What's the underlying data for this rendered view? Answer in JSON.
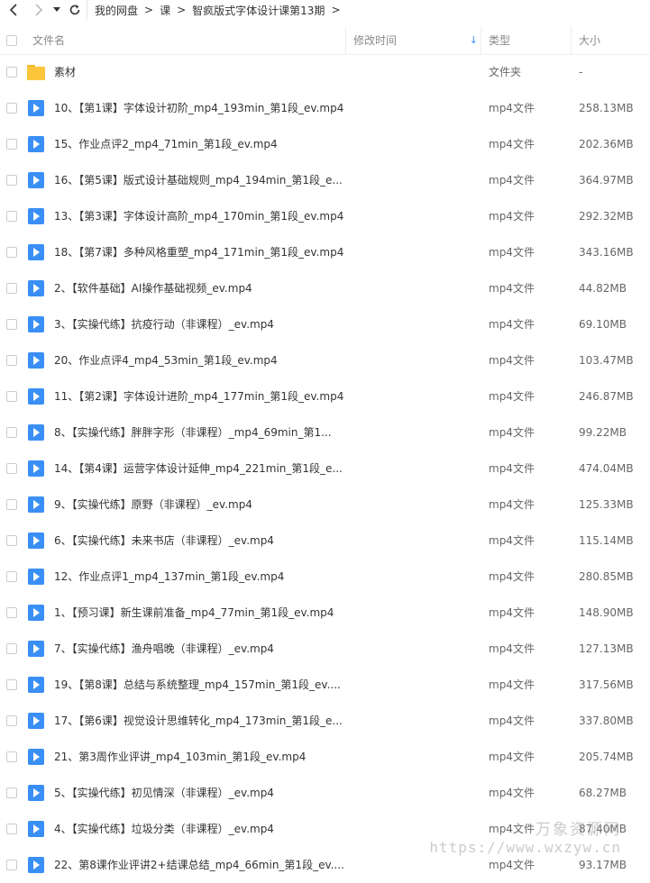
{
  "nav": {
    "breadcrumb": [
      "我的网盘",
      "课",
      "智疯版式字体设计课第13期"
    ],
    "separator": ">"
  },
  "header": {
    "name": "文件名",
    "modified": "修改时间",
    "type": "类型",
    "size": "大小",
    "sort_indicator": "↓"
  },
  "files": [
    {
      "name": "素材",
      "type": "文件夹",
      "size": "-",
      "icon": "folder-icon"
    },
    {
      "name": "10、【第1课】字体设计初阶_mp4_193min_第1段_ev.mp4",
      "type": "mp4文件",
      "size": "258.13MB",
      "icon": "video-file-icon"
    },
    {
      "name": "15、作业点评2_mp4_71min_第1段_ev.mp4",
      "type": "mp4文件",
      "size": "202.36MB",
      "icon": "video-file-icon"
    },
    {
      "name": "16、【第5课】版式设计基础规则_mp4_194min_第1段_e...",
      "type": "mp4文件",
      "size": "364.97MB",
      "icon": "video-file-icon"
    },
    {
      "name": "13、【第3课】字体设计高阶_mp4_170min_第1段_ev.mp4",
      "type": "mp4文件",
      "size": "292.32MB",
      "icon": "video-file-icon"
    },
    {
      "name": "18、【第7课】多种风格重塑_mp4_171min_第1段_ev.mp4",
      "type": "mp4文件",
      "size": "343.16MB",
      "icon": "video-file-icon"
    },
    {
      "name": "2、【软件基础】AI操作基础视频_ev.mp4",
      "type": "mp4文件",
      "size": "44.82MB",
      "icon": "video-file-icon"
    },
    {
      "name": "3、【实操代练】抗疫行动（非课程）_ev.mp4",
      "type": "mp4文件",
      "size": "69.10MB",
      "icon": "video-file-icon"
    },
    {
      "name": "20、作业点评4_mp4_53min_第1段_ev.mp4",
      "type": "mp4文件",
      "size": "103.47MB",
      "icon": "video-file-icon"
    },
    {
      "name": "11、【第2课】字体设计进阶_mp4_177min_第1段_ev.mp4",
      "type": "mp4文件",
      "size": "246.87MB",
      "icon": "video-file-icon"
    },
    {
      "name": "8、【实操代练】胖胖字形（非课程）_mp4_69min_第1...",
      "type": "mp4文件",
      "size": "99.22MB",
      "icon": "video-file-icon"
    },
    {
      "name": "14、【第4课】运营字体设计延伸_mp4_221min_第1段_e...",
      "type": "mp4文件",
      "size": "474.04MB",
      "icon": "video-file-icon"
    },
    {
      "name": "9、【实操代练】原野（非课程）_ev.mp4",
      "type": "mp4文件",
      "size": "125.33MB",
      "icon": "video-file-icon"
    },
    {
      "name": "6、【实操代练】未来书店（非课程）_ev.mp4",
      "type": "mp4文件",
      "size": "115.14MB",
      "icon": "video-file-icon"
    },
    {
      "name": "12、作业点评1_mp4_137min_第1段_ev.mp4",
      "type": "mp4文件",
      "size": "280.85MB",
      "icon": "video-file-icon"
    },
    {
      "name": "1、【预习课】新生课前准备_mp4_77min_第1段_ev.mp4",
      "type": "mp4文件",
      "size": "148.90MB",
      "icon": "video-file-icon"
    },
    {
      "name": "7、【实操代练】渔舟唱晚（非课程）_ev.mp4",
      "type": "mp4文件",
      "size": "127.13MB",
      "icon": "video-file-icon"
    },
    {
      "name": "19、【第8课】总结与系统整理_mp4_157min_第1段_ev....",
      "type": "mp4文件",
      "size": "317.56MB",
      "icon": "video-file-icon"
    },
    {
      "name": "17、【第6课】视觉设计思维转化_mp4_173min_第1段_e...",
      "type": "mp4文件",
      "size": "337.80MB",
      "icon": "video-file-icon"
    },
    {
      "name": "21、第3周作业评讲_mp4_103min_第1段_ev.mp4",
      "type": "mp4文件",
      "size": "205.74MB",
      "icon": "video-file-icon"
    },
    {
      "name": "5、【实操代练】初见情深（非课程）_ev.mp4",
      "type": "mp4文件",
      "size": "68.27MB",
      "icon": "video-file-icon"
    },
    {
      "name": "4、【实操代练】垃圾分类（非课程）_ev.mp4",
      "type": "mp4文件",
      "size": "87.40MB",
      "icon": "video-file-icon"
    },
    {
      "name": "22、第8课作业评讲2+结课总结_mp4_66min_第1段_ev....",
      "type": "mp4文件",
      "size": "93.17MB",
      "icon": "video-file-icon"
    }
  ],
  "watermark": {
    "line1": "万象资源网",
    "line2": "https://www.wxzyw.cn"
  }
}
